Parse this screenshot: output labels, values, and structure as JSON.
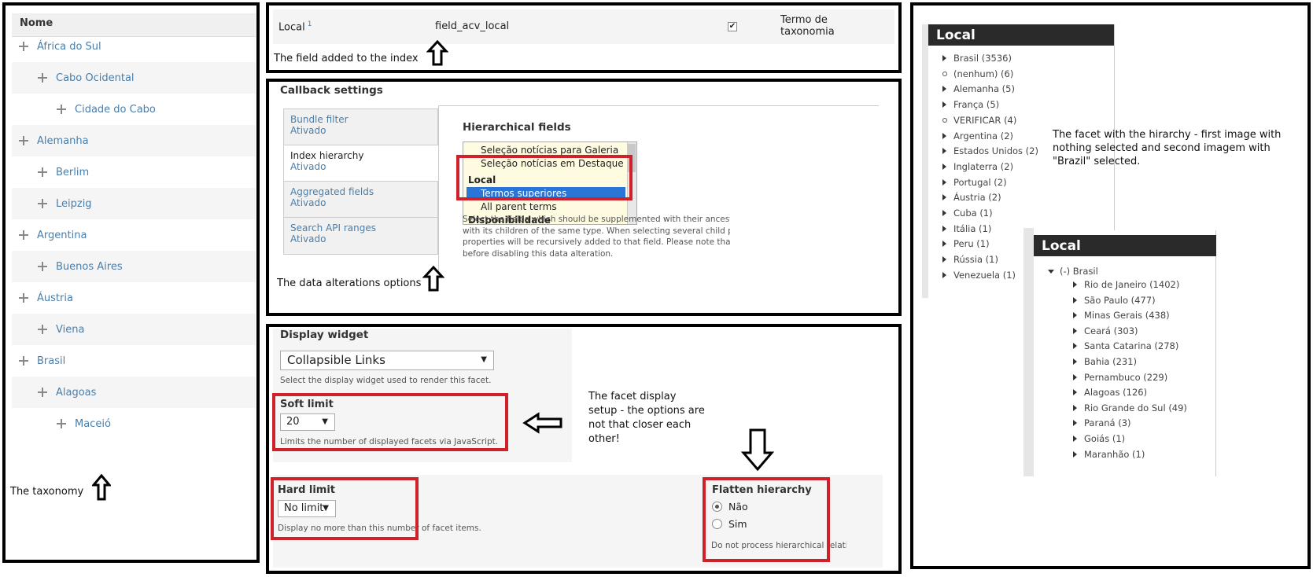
{
  "taxonomy": {
    "header": "Nome",
    "items": [
      {
        "label": "África do Sul",
        "level": 0
      },
      {
        "label": "Cabo Ocidental",
        "level": 1
      },
      {
        "label": "Cidade do Cabo",
        "level": 2
      },
      {
        "label": "Alemanha",
        "level": 0
      },
      {
        "label": "Berlim",
        "level": 1
      },
      {
        "label": "Leipzig",
        "level": 1
      },
      {
        "label": "Argentina",
        "level": 0
      },
      {
        "label": "Buenos Aires",
        "level": 1
      },
      {
        "label": "Áustria",
        "level": 0
      },
      {
        "label": "Viena",
        "level": 1
      },
      {
        "label": "Brasil",
        "level": 0
      },
      {
        "label": "Alagoas",
        "level": 1
      },
      {
        "label": "Maceió",
        "level": 2
      }
    ],
    "note": "The taxonomy"
  },
  "index_field": {
    "label": "Local",
    "superscript": "1",
    "machine_name": "field_acv_local",
    "type_line1": "Termo de",
    "type_line2": "taxonomia",
    "checked": "✔",
    "note": "The field added to the index"
  },
  "callback": {
    "title": "Callback settings",
    "tabs": [
      {
        "title": "Bundle filter",
        "status": "Ativado"
      },
      {
        "title": "Index hierarchy",
        "status": "Ativado"
      },
      {
        "title": "Aggregated fields",
        "status": "Ativado"
      },
      {
        "title": "Search API ranges",
        "status": "Ativado"
      }
    ],
    "hierarchical_title": "Hierarchical fields",
    "options": {
      "o1": "Seleção notícias para Galeria",
      "o2": "Seleção notícias em Destaque",
      "group_local": "Local",
      "o3": "Termos superiores",
      "o4": "All parent terms",
      "group_disp": "Disponibilidade"
    },
    "description": {
      "l1": "Select the fields which should be supplemented with their ancestors",
      "l2": "with its children of the same type. When selecting several child prop",
      "l3": "properties will be recursively added to that field. Please note that yo",
      "l4": "before disabling this data alteration."
    },
    "note": "The data alterations options"
  },
  "display": {
    "widget_title": "Display widget",
    "widget_value": "Collapsible Links",
    "widget_desc": "Select the display widget used to render this facet.",
    "soft_title": "Soft limit",
    "soft_value": "20",
    "soft_desc": "Limits the number of displayed facets via JavaScript.",
    "hard_title": "Hard limit",
    "hard_value": "No limit",
    "hard_desc": "Display no more than this number of facet items.",
    "flatten_title": "Flatten hierarchy",
    "flatten_opt1": "Não",
    "flatten_opt2": "Sim",
    "flatten_desc": "Do not process hierarchical relati",
    "note_l1": "The facet display",
    "note_l2": "setup - the options are",
    "note_l3": "not that closer each",
    "note_l4": "other!"
  },
  "facet": {
    "title1": "Local",
    "list1": [
      {
        "label": "Brasil (3536)",
        "bullet": "tri"
      },
      {
        "label": "(nenhum) (6)",
        "bullet": "circ"
      },
      {
        "label": "Alemanha (5)",
        "bullet": "tri"
      },
      {
        "label": "França (5)",
        "bullet": "tri"
      },
      {
        "label": "VERIFICAR (4)",
        "bullet": "circ"
      },
      {
        "label": "Argentina (2)",
        "bullet": "tri"
      },
      {
        "label": "Estados Unidos (2)",
        "bullet": "tri"
      },
      {
        "label": "Inglaterra (2)",
        "bullet": "tri"
      },
      {
        "label": "Portugal (2)",
        "bullet": "tri"
      },
      {
        "label": "Áustria (2)",
        "bullet": "tri"
      },
      {
        "label": "Cuba (1)",
        "bullet": "tri"
      },
      {
        "label": "Itália (1)",
        "bullet": "tri"
      },
      {
        "label": "Peru (1)",
        "bullet": "tri"
      },
      {
        "label": "Rússia (1)",
        "bullet": "tri"
      },
      {
        "label": "Venezuela (1)",
        "bullet": "tri"
      }
    ],
    "note_l1": "The facet with the hirarchy - first image with",
    "note_l2": "nothing selected and second imagem with",
    "note_l3": "\"Brazil\" selected.",
    "title2": "Local",
    "parent": "(-) Brasil",
    "list2": [
      "Rio de Janeiro (1402)",
      "São Paulo (477)",
      "Minas Gerais (438)",
      "Ceará (303)",
      "Santa Catarina (278)",
      "Bahia (231)",
      "Pernambuco (229)",
      "Alagoas (126)",
      "Rio Grande do Sul (49)",
      "Paraná (3)",
      "Goiás (1)",
      "Maranhão (1)"
    ]
  },
  "colors": {
    "link": "#4a7eaa",
    "highlight_red": "#d0202a",
    "selected_blue": "#2a76d6",
    "facet_title_bg": "#2a2a2a"
  }
}
